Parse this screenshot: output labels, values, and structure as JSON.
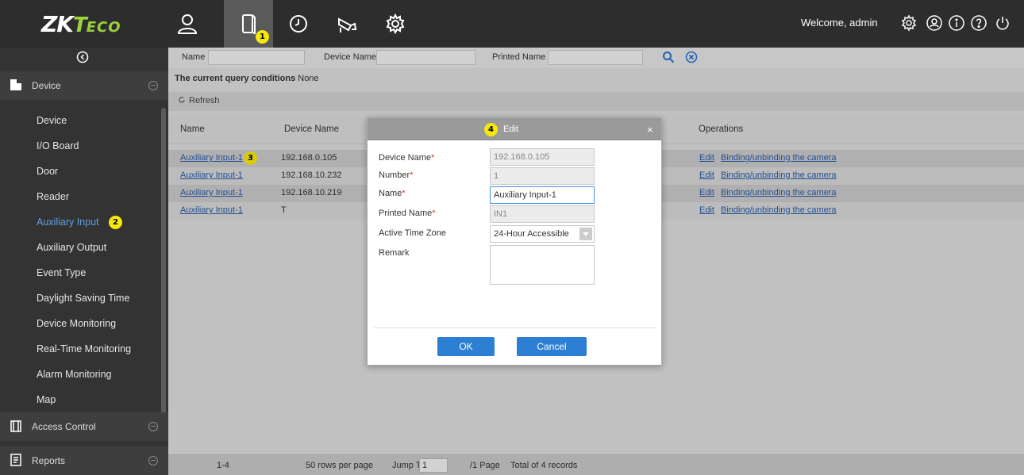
{
  "brand": {
    "zk": "ZK",
    "t": "T",
    "eco": "ECO"
  },
  "topbar": {
    "welcome": "Welcome, admin",
    "nav_markers": {
      "doors": "1"
    }
  },
  "sidebar": {
    "groups": {
      "device": "Device",
      "access_control": "Access Control",
      "reports": "Reports"
    },
    "items": [
      {
        "label": "Device"
      },
      {
        "label": "I/O Board"
      },
      {
        "label": "Door"
      },
      {
        "label": "Reader"
      },
      {
        "label": "Auxiliary Input",
        "marker": "2"
      },
      {
        "label": "Auxiliary Output"
      },
      {
        "label": "Event Type"
      },
      {
        "label": "Daylight Saving Time"
      },
      {
        "label": "Device Monitoring"
      },
      {
        "label": "Real-Time Monitoring"
      },
      {
        "label": "Alarm Monitoring"
      },
      {
        "label": "Map"
      }
    ]
  },
  "filter": {
    "name_label": "Name",
    "device_name_label": "Device Name",
    "printed_name_label": "Printed Name"
  },
  "query": {
    "label": "The current query conditions",
    "value": "None"
  },
  "toolbar": {
    "refresh": "Refresh"
  },
  "table": {
    "headers": {
      "name": "Name",
      "device_name": "Device Name",
      "operations": "Operations"
    },
    "rows": [
      {
        "name": "Auxiliary Input-1",
        "device": "192.168.0.105",
        "op_edit": "Edit",
        "op_binding": "Binding/unbinding the camera",
        "marker": "3"
      },
      {
        "name": "Auxiliary Input-1",
        "device": "192.168.10.232",
        "op_edit": "Edit",
        "op_binding": "Binding/unbinding the camera"
      },
      {
        "name": "Auxiliary Input-1",
        "device": "192.168.10.219",
        "op_edit": "Edit",
        "op_binding": "Binding/unbinding the camera"
      },
      {
        "name": "Auxiliary Input-1",
        "device": "T",
        "op_edit": "Edit",
        "op_binding": "Binding/unbinding the camera"
      }
    ]
  },
  "pager": {
    "range": "1-4",
    "rows_per_page": "50 rows per page",
    "jump_label": "Jump To",
    "jump_value": "1",
    "pages": "/1 Page",
    "total": "Total of 4 records"
  },
  "dialog": {
    "title": "Edit",
    "marker": "4",
    "close": "×",
    "fields": {
      "device_name_label": "Device Name",
      "device_name_value": "192.168.0.105",
      "number_label": "Number",
      "number_value": "1",
      "name_label": "Name",
      "name_value": "Auxiliary Input-1",
      "printed_name_label": "Printed Name",
      "printed_name_value": "IN1",
      "active_time_zone_label": "Active Time Zone",
      "active_time_zone_value": "24-Hour Accessible",
      "remark_label": "Remark",
      "required_mark": "*"
    },
    "ok": "OK",
    "cancel": "Cancel"
  },
  "colors": {
    "topbar": "#2d2d2d",
    "sidebar": "#333333",
    "accent_link": "#2a5aa8",
    "active_item": "#5fa0e0",
    "button": "#2d7fd3",
    "marker": "#f6e70d",
    "brand_green": "#9cd23a"
  }
}
